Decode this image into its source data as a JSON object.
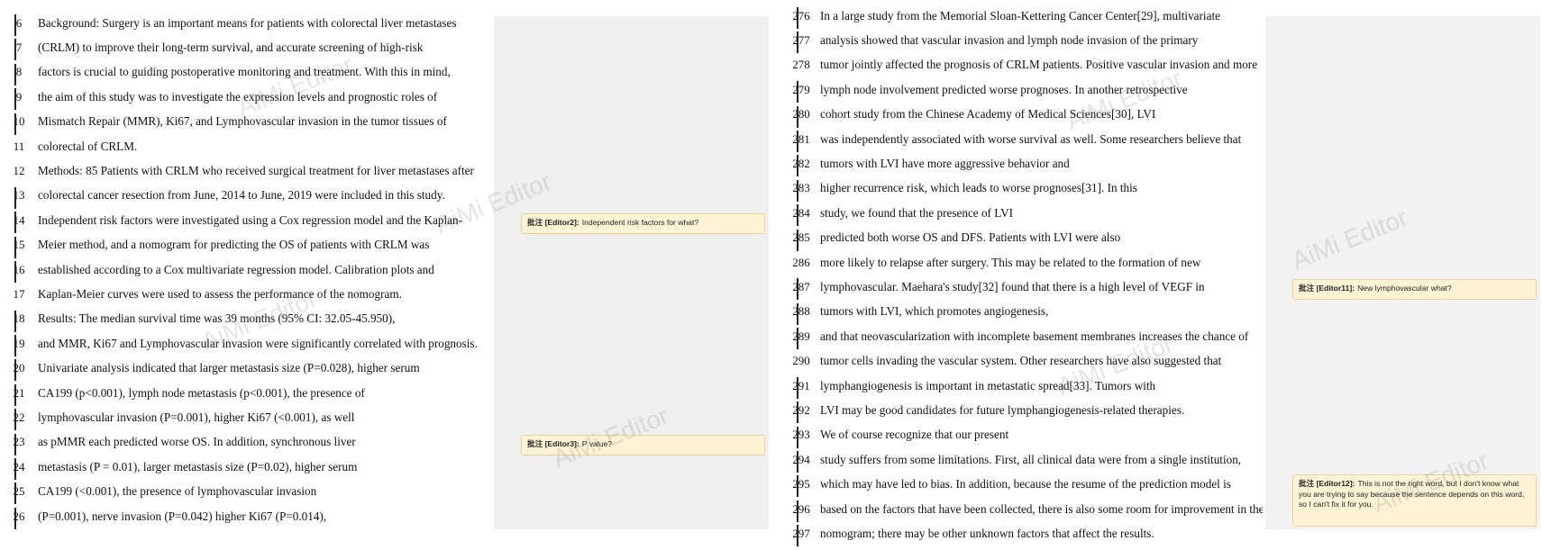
{
  "lines": [
    {
      "left": "6",
      "left_text": "Background: Surgery is an important means for patients with colorectal liver metastases",
      "right": "276",
      "right_text": "In a large study from the Memorial Sloan-Kettering Cancer Center[29], multivariate"
    },
    {
      "left": "7",
      "left_text": "(CRLM) to improve their long-term survival, and accurate screening of high-risk",
      "right": "277",
      "right_text": "analysis showed that vascular invasion and lymph node invasion of the primary"
    },
    {
      "left": "8",
      "left_text": "factors is crucial to guiding postoperative monitoring and treatment. With this in mind,",
      "right": "278",
      "right_text": "tumor jointly affected the prognosis of CRLM patients. Positive vascular invasion and more"
    },
    {
      "left": "9",
      "left_text": "the aim of this study was to investigate the expression levels and prognostic roles of",
      "right": "279",
      "right_text": "lymph node involvement predicted worse prognoses. In another retrospective"
    },
    {
      "left": "10",
      "left_text": "Mismatch Repair (MMR), Ki67, and Lymphovascular invasion in the tumor tissues of",
      "right": "280",
      "right_text": "cohort study from the Chinese Academy of Medical Sciences[30], LVI"
    },
    {
      "left": "11",
      "left_text": "colorectal of CRLM.",
      "right": "281",
      "right_text": "was independently associated with worse survival as well. Some researchers believe that"
    },
    {
      "left": "12",
      "left_text": "Methods: 85 Patients with CRLM who received surgical treatment for liver metastases after",
      "right": "282",
      "right_text": "tumors with LVI have more aggressive behavior and"
    },
    {
      "left": "13",
      "left_text": "colorectal cancer resection from June, 2014 to June, 2019 were included in this study.",
      "right": "283",
      "right_text": "higher recurrence risk, which leads to worse prognoses[31]. In this"
    },
    {
      "left": "14",
      "left_text": "Independent risk factors were investigated using a Cox regression model and the Kaplan-",
      "right": "284",
      "right_text": "study, we found that the presence of LVI"
    },
    {
      "left": "15",
      "left_text": "Meier method, and a nomogram for predicting the OS of patients with CRLM was",
      "right": "285",
      "right_text": "predicted both worse OS and DFS. Patients with LVI were also"
    },
    {
      "left": "16",
      "left_text": "established according to a Cox multivariate regression model. Calibration plots and",
      "right": "286",
      "right_text": "more likely to relapse after surgery. This may be related to the formation of new"
    },
    {
      "left": "17",
      "left_text": "Kaplan-Meier curves were used to assess the performance of the nomogram.",
      "right": "287",
      "right_text": "lymphovascular. Maehara's study[32] found that there is a high level of VEGF in"
    },
    {
      "left": "18",
      "left_text": "Results: The median survival time was 39 months (95% CI: 32.05-45.950),",
      "right": "288",
      "right_text": "tumors with LVI, which promotes angiogenesis,"
    },
    {
      "left": "19",
      "left_text": "and MMR, Ki67 and Lymphovascular invasion were significantly correlated with prognosis.",
      "right": "289",
      "right_text": "and that neovascularization with incomplete basement membranes increases the chance of"
    },
    {
      "left": "20",
      "left_text": "Univariate analysis indicated that larger metastasis size (P=0.028), higher serum",
      "right": "290",
      "right_text": "tumor cells invading the vascular system. Other researchers have also suggested that"
    },
    {
      "left": "21",
      "left_text": "CA199 (p<0.001), lymph node metastasis (p<0.001), the presence of",
      "right": "291",
      "right_text": "lymphangiogenesis is important in metastatic spread[33]. Tumors with"
    },
    {
      "left": "22",
      "left_text": "lymphovascular invasion (P=0.001), higher Ki67 (<0.001), as well",
      "right": "292",
      "right_text": "LVI may be good candidates for future lymphangiogenesis-related therapies."
    },
    {
      "left": "23",
      "left_text": "as pMMR each predicted worse OS. In addition, synchronous liver",
      "right": "293",
      "right_text": "We of course recognize that our present"
    },
    {
      "left": "24",
      "left_text": "metastasis (P = 0.01), larger metastasis size (P=0.02), higher serum",
      "right": "294",
      "right_text": "study suffers from some limitations. First, all clinical data were from a single institution,"
    },
    {
      "left": "25",
      "left_text": "CA199 (<0.001), the presence of lymphovascular invasion",
      "right": "295",
      "right_text": "which may have led to bias. In addition, because the resume of the prediction model is"
    },
    {
      "left": "26",
      "left_text": "(P=0.001), nerve invasion (P=0.042) higher Ki67 (P=0.014),",
      "right": "296",
      "right_text": "based on the factors that have been collected, there is also some room for improvement in the"
    },
    {
      "left": "",
      "left_text": "",
      "right": "297",
      "right_text": "nomogram; there may be other unknown factors that affect the results."
    }
  ],
  "comments": [
    {
      "author": "批注 [Editor2]:",
      "text": "Independent risk factors for what?"
    },
    {
      "author": "批注 [Editor3]:",
      "text": "P value?"
    },
    {
      "author": "批注 [Editor11]:",
      "text": "New lymphovascular what?"
    },
    {
      "author": "批注 [Editor12]:",
      "text": "This is not the right word, but I don't know what you are trying to say because the sentence depends on this word, so I can't fix it for you."
    }
  ],
  "watermark": "AiMi Editor"
}
